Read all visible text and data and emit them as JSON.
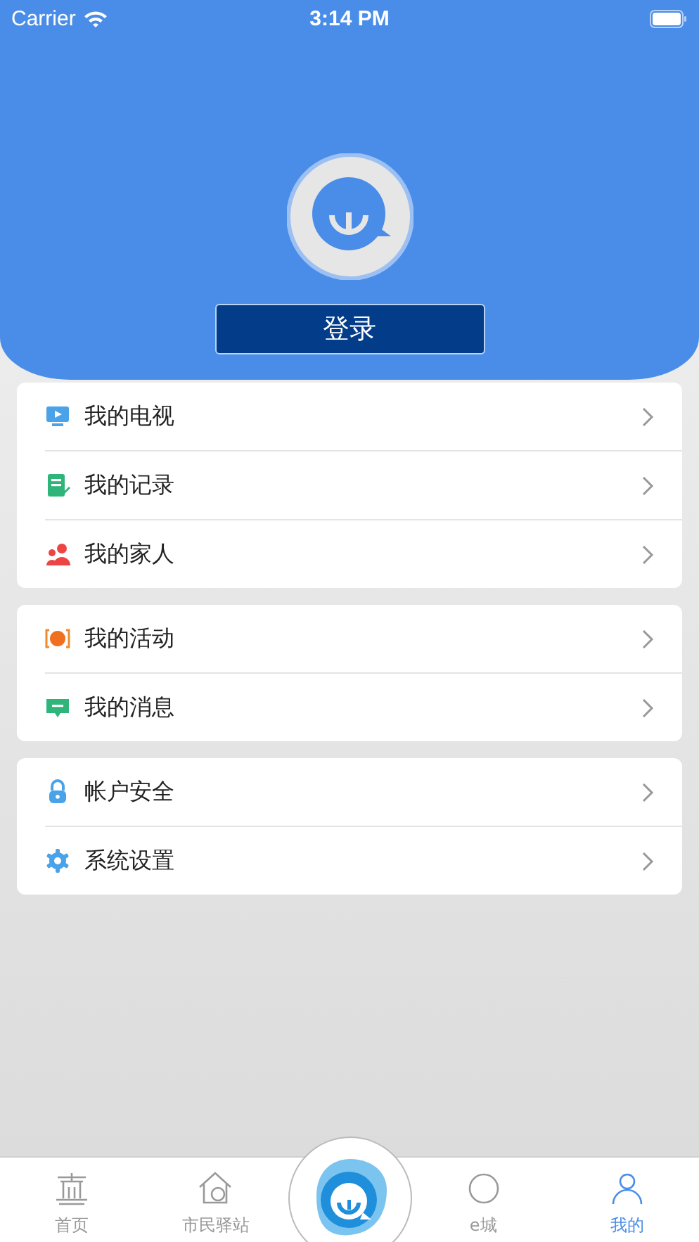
{
  "status_bar": {
    "carrier": "Carrier",
    "time": "3:14 PM"
  },
  "profile": {
    "login_button": "登录"
  },
  "menu_groups": [
    {
      "items": [
        {
          "label": "我的电视"
        },
        {
          "label": "我的记录"
        },
        {
          "label": "我的家人"
        }
      ]
    },
    {
      "items": [
        {
          "label": "我的活动"
        },
        {
          "label": "我的消息"
        }
      ]
    },
    {
      "items": [
        {
          "label": "帐户安全"
        },
        {
          "label": "系统设置"
        }
      ]
    }
  ],
  "tab_bar": [
    {
      "kind": "tab",
      "label": "首页",
      "selected": false
    },
    {
      "kind": "tab",
      "label": "市民驿站",
      "selected": false
    },
    {
      "kind": "logo"
    },
    {
      "kind": "tab",
      "label": "e城",
      "selected": false
    },
    {
      "kind": "tab",
      "label": "我的",
      "selected": true
    }
  ]
}
